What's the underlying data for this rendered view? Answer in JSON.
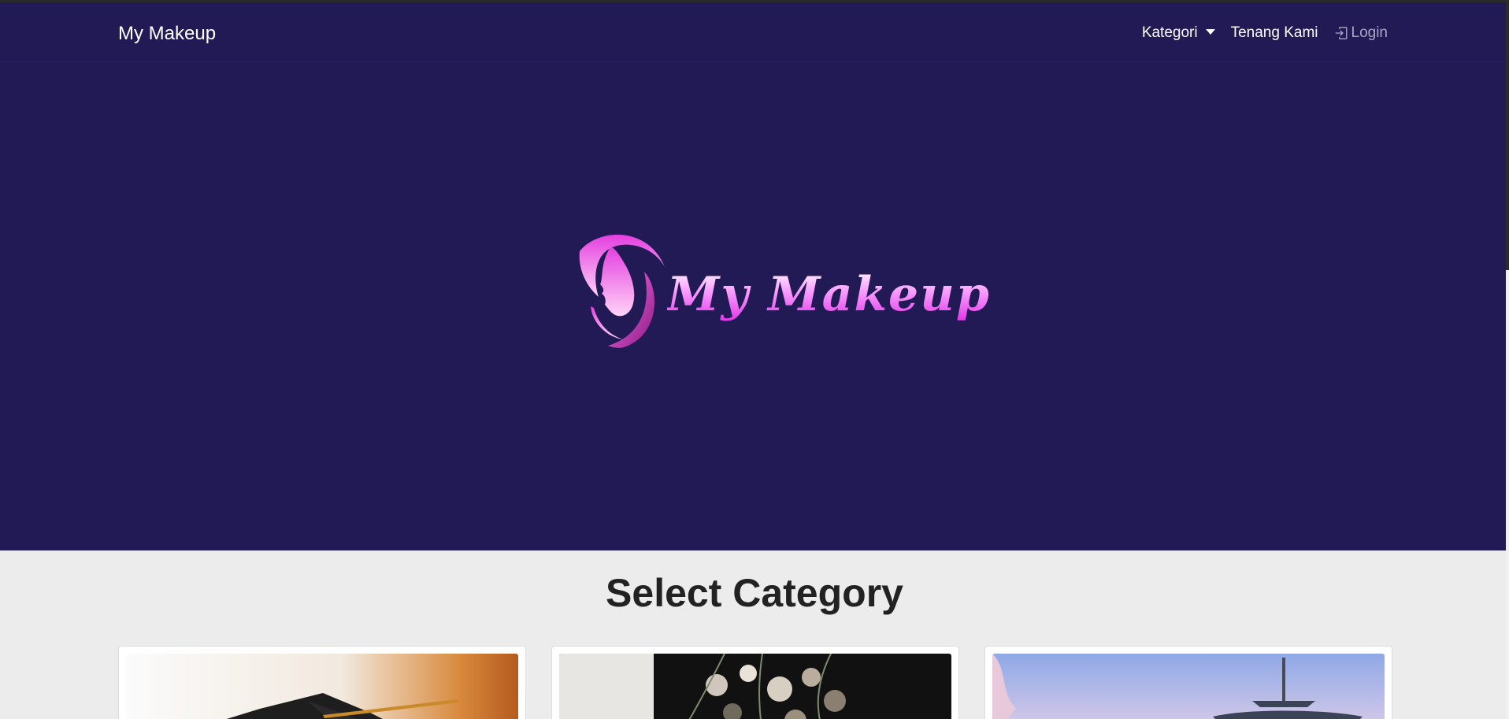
{
  "nav": {
    "brand": "My Makeup",
    "items": [
      {
        "label": "Kategori",
        "has_caret": true
      },
      {
        "label": "Tenang Kami"
      },
      {
        "label": "Login",
        "icon": "login-icon"
      }
    ]
  },
  "hero": {
    "logo_text": "My Makeup",
    "logo_icon": "woman-face-silhouette-icon",
    "background": "#221a55",
    "accent": "#e233e8"
  },
  "main": {
    "section_title": "Select Category",
    "cards": [
      {
        "image": "graduation-cap-image"
      },
      {
        "image": "wedding-bouquet-image"
      },
      {
        "image": "korean-temple-image"
      }
    ]
  }
}
